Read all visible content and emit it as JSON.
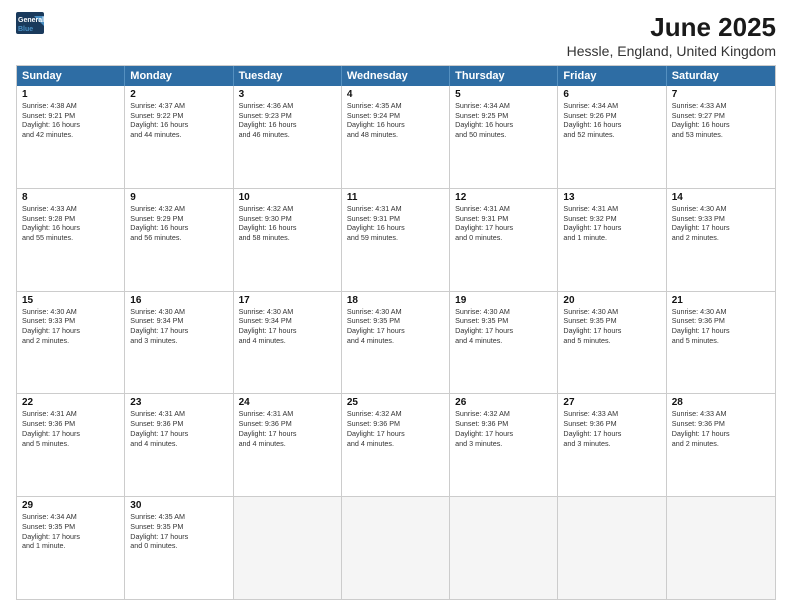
{
  "logo": {
    "line1": "General",
    "line2": "Blue"
  },
  "title": "June 2025",
  "subtitle": "Hessle, England, United Kingdom",
  "days": [
    "Sunday",
    "Monday",
    "Tuesday",
    "Wednesday",
    "Thursday",
    "Friday",
    "Saturday"
  ],
  "weeks": [
    [
      {
        "num": "1",
        "text": "Sunrise: 4:38 AM\nSunset: 9:21 PM\nDaylight: 16 hours\nand 42 minutes."
      },
      {
        "num": "2",
        "text": "Sunrise: 4:37 AM\nSunset: 9:22 PM\nDaylight: 16 hours\nand 44 minutes."
      },
      {
        "num": "3",
        "text": "Sunrise: 4:36 AM\nSunset: 9:23 PM\nDaylight: 16 hours\nand 46 minutes."
      },
      {
        "num": "4",
        "text": "Sunrise: 4:35 AM\nSunset: 9:24 PM\nDaylight: 16 hours\nand 48 minutes."
      },
      {
        "num": "5",
        "text": "Sunrise: 4:34 AM\nSunset: 9:25 PM\nDaylight: 16 hours\nand 50 minutes."
      },
      {
        "num": "6",
        "text": "Sunrise: 4:34 AM\nSunset: 9:26 PM\nDaylight: 16 hours\nand 52 minutes."
      },
      {
        "num": "7",
        "text": "Sunrise: 4:33 AM\nSunset: 9:27 PM\nDaylight: 16 hours\nand 53 minutes."
      }
    ],
    [
      {
        "num": "8",
        "text": "Sunrise: 4:33 AM\nSunset: 9:28 PM\nDaylight: 16 hours\nand 55 minutes."
      },
      {
        "num": "9",
        "text": "Sunrise: 4:32 AM\nSunset: 9:29 PM\nDaylight: 16 hours\nand 56 minutes."
      },
      {
        "num": "10",
        "text": "Sunrise: 4:32 AM\nSunset: 9:30 PM\nDaylight: 16 hours\nand 58 minutes."
      },
      {
        "num": "11",
        "text": "Sunrise: 4:31 AM\nSunset: 9:31 PM\nDaylight: 16 hours\nand 59 minutes."
      },
      {
        "num": "12",
        "text": "Sunrise: 4:31 AM\nSunset: 9:31 PM\nDaylight: 17 hours\nand 0 minutes."
      },
      {
        "num": "13",
        "text": "Sunrise: 4:31 AM\nSunset: 9:32 PM\nDaylight: 17 hours\nand 1 minute."
      },
      {
        "num": "14",
        "text": "Sunrise: 4:30 AM\nSunset: 9:33 PM\nDaylight: 17 hours\nand 2 minutes."
      }
    ],
    [
      {
        "num": "15",
        "text": "Sunrise: 4:30 AM\nSunset: 9:33 PM\nDaylight: 17 hours\nand 2 minutes."
      },
      {
        "num": "16",
        "text": "Sunrise: 4:30 AM\nSunset: 9:34 PM\nDaylight: 17 hours\nand 3 minutes."
      },
      {
        "num": "17",
        "text": "Sunrise: 4:30 AM\nSunset: 9:34 PM\nDaylight: 17 hours\nand 4 minutes."
      },
      {
        "num": "18",
        "text": "Sunrise: 4:30 AM\nSunset: 9:35 PM\nDaylight: 17 hours\nand 4 minutes."
      },
      {
        "num": "19",
        "text": "Sunrise: 4:30 AM\nSunset: 9:35 PM\nDaylight: 17 hours\nand 4 minutes."
      },
      {
        "num": "20",
        "text": "Sunrise: 4:30 AM\nSunset: 9:35 PM\nDaylight: 17 hours\nand 5 minutes."
      },
      {
        "num": "21",
        "text": "Sunrise: 4:30 AM\nSunset: 9:36 PM\nDaylight: 17 hours\nand 5 minutes."
      }
    ],
    [
      {
        "num": "22",
        "text": "Sunrise: 4:31 AM\nSunset: 9:36 PM\nDaylight: 17 hours\nand 5 minutes."
      },
      {
        "num": "23",
        "text": "Sunrise: 4:31 AM\nSunset: 9:36 PM\nDaylight: 17 hours\nand 4 minutes."
      },
      {
        "num": "24",
        "text": "Sunrise: 4:31 AM\nSunset: 9:36 PM\nDaylight: 17 hours\nand 4 minutes."
      },
      {
        "num": "25",
        "text": "Sunrise: 4:32 AM\nSunset: 9:36 PM\nDaylight: 17 hours\nand 4 minutes."
      },
      {
        "num": "26",
        "text": "Sunrise: 4:32 AM\nSunset: 9:36 PM\nDaylight: 17 hours\nand 3 minutes."
      },
      {
        "num": "27",
        "text": "Sunrise: 4:33 AM\nSunset: 9:36 PM\nDaylight: 17 hours\nand 3 minutes."
      },
      {
        "num": "28",
        "text": "Sunrise: 4:33 AM\nSunset: 9:36 PM\nDaylight: 17 hours\nand 2 minutes."
      }
    ],
    [
      {
        "num": "29",
        "text": "Sunrise: 4:34 AM\nSunset: 9:35 PM\nDaylight: 17 hours\nand 1 minute."
      },
      {
        "num": "30",
        "text": "Sunrise: 4:35 AM\nSunset: 9:35 PM\nDaylight: 17 hours\nand 0 minutes."
      },
      {
        "num": "",
        "text": ""
      },
      {
        "num": "",
        "text": ""
      },
      {
        "num": "",
        "text": ""
      },
      {
        "num": "",
        "text": ""
      },
      {
        "num": "",
        "text": ""
      }
    ]
  ]
}
